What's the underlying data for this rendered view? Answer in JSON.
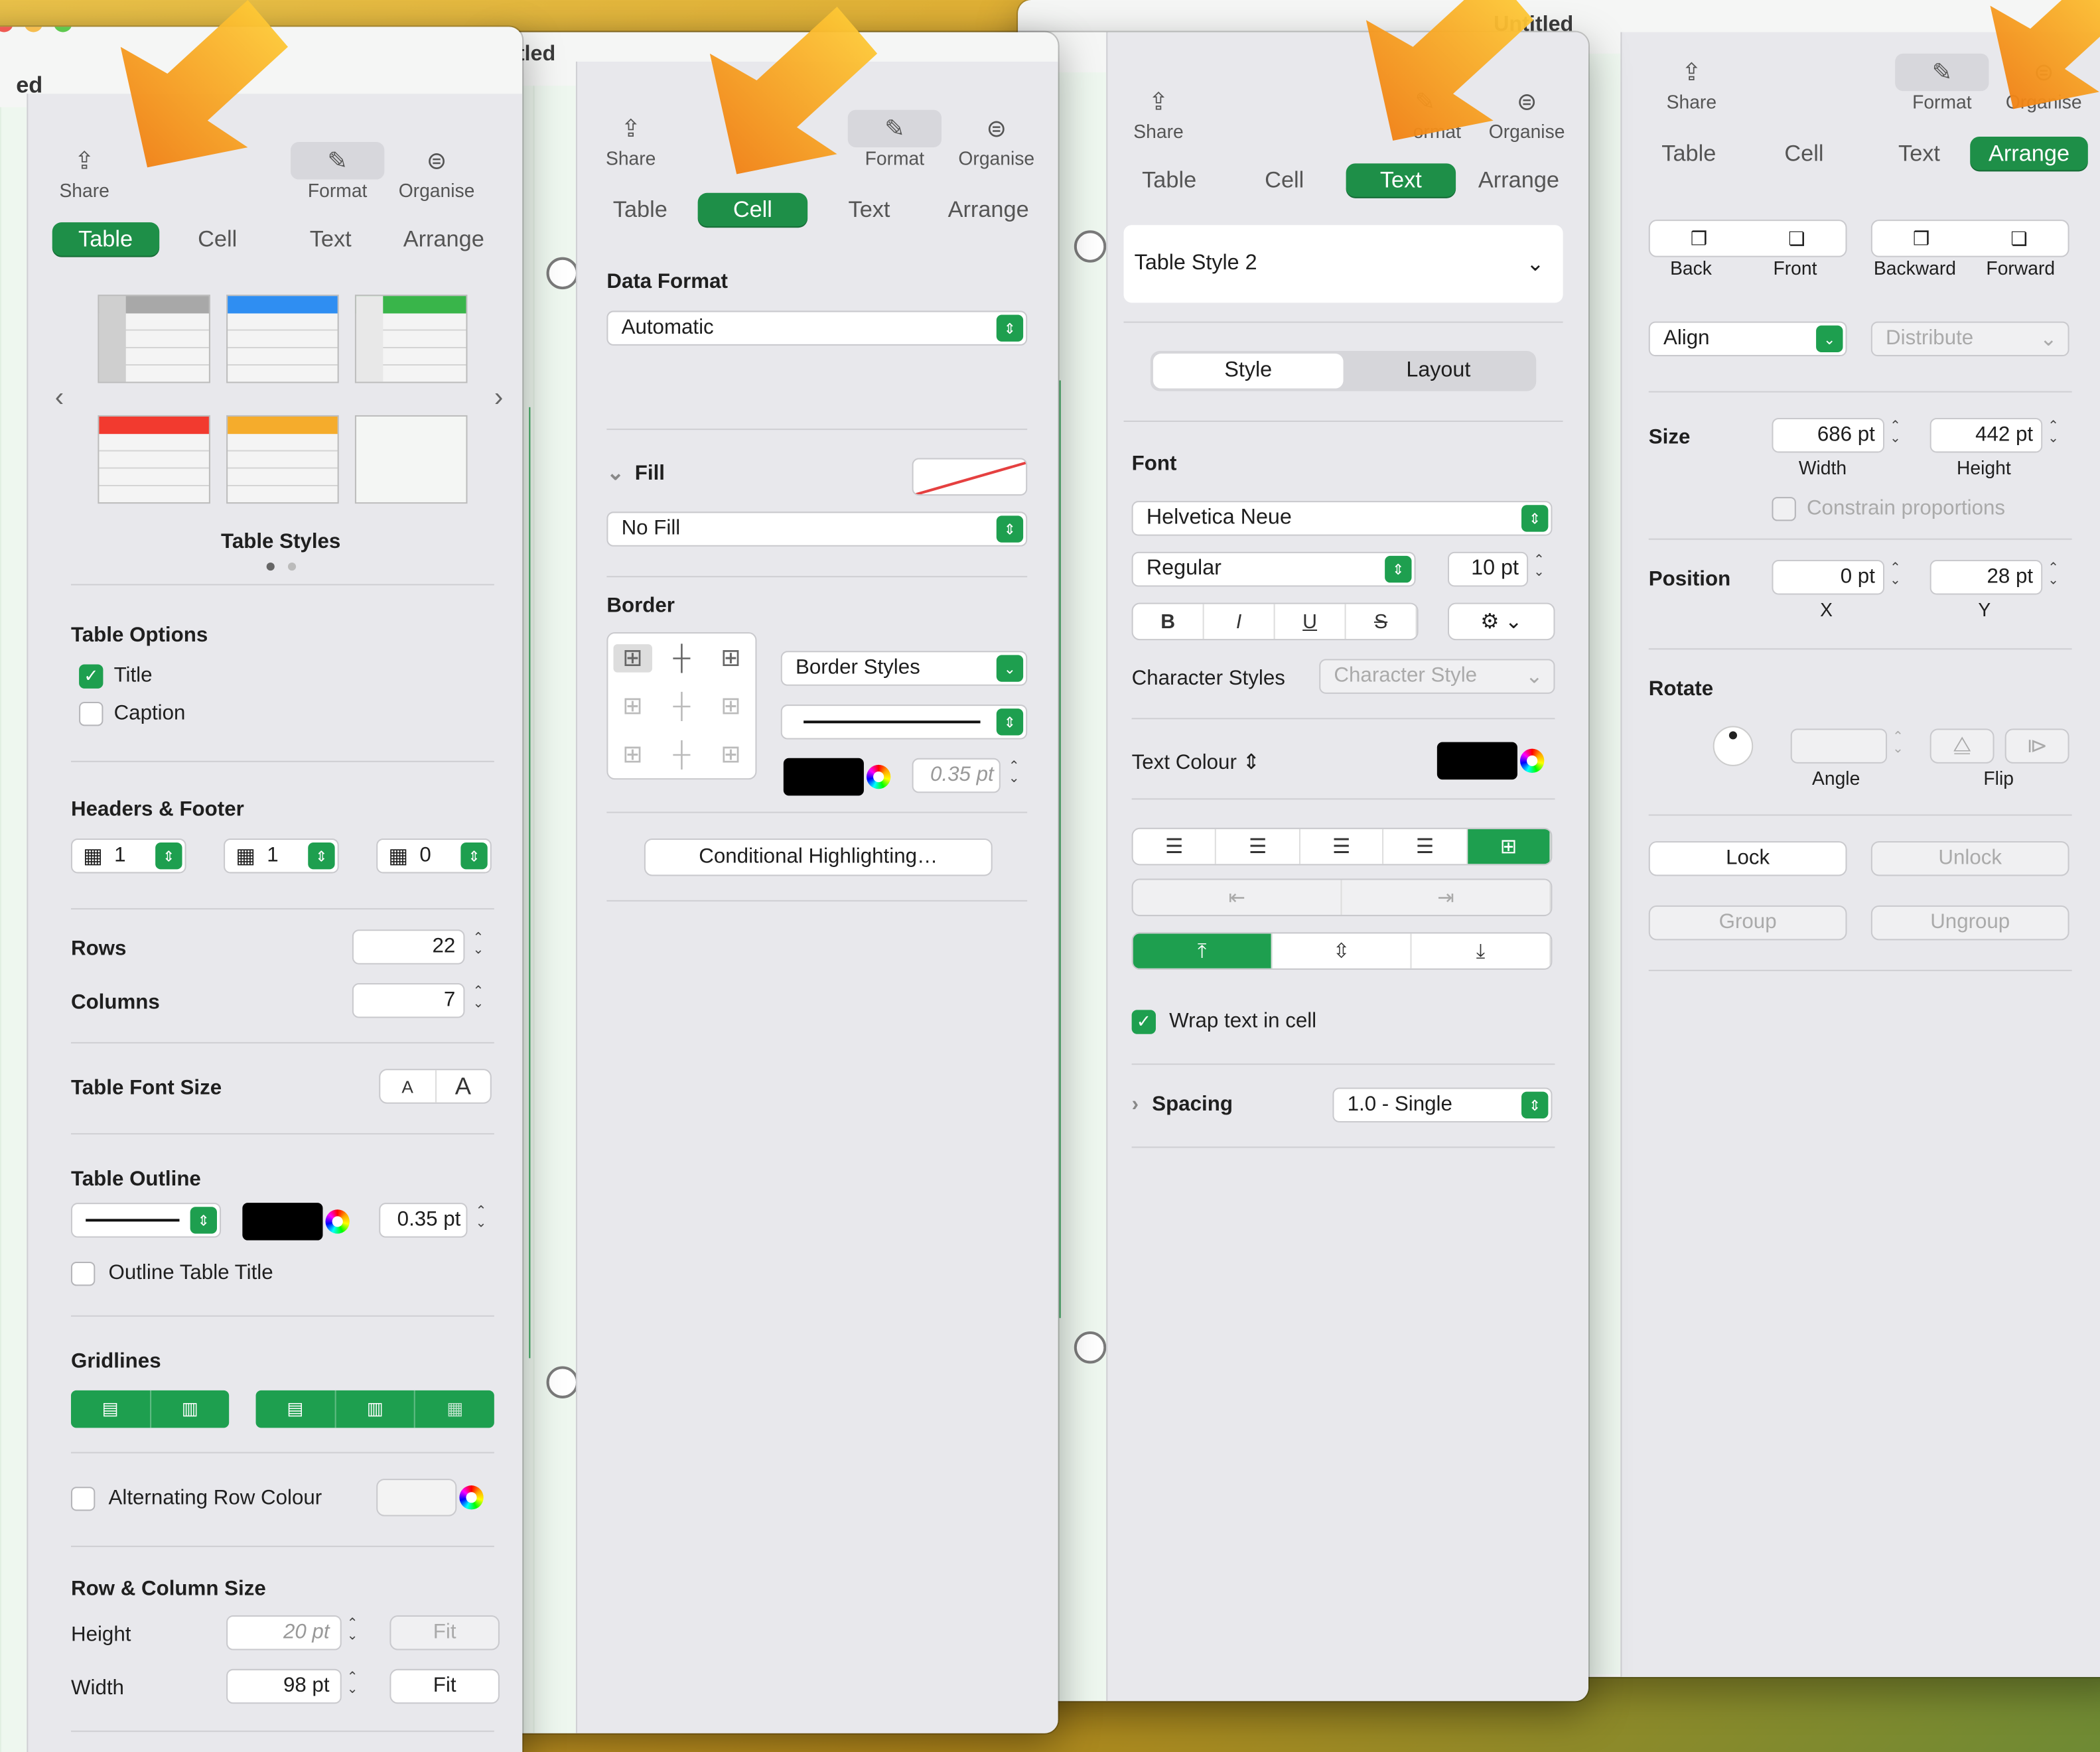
{
  "window_title": "Untitled",
  "window_title_partial": "ed",
  "toolbar": {
    "share": "Share",
    "format": "Format",
    "organise": "Organise",
    "format_partial": "ormat",
    "organise_partial": "Organise"
  },
  "tabs": [
    "Table",
    "Cell",
    "Text",
    "Arrange"
  ],
  "table_panel": {
    "styles_label": "Table Styles",
    "options_title": "Table Options",
    "title_label": "Title",
    "caption_label": "Caption",
    "headers_title": "Headers & Footer",
    "header_rows": "1",
    "header_cols": "1",
    "footer_rows": "0",
    "rows_label": "Rows",
    "rows_value": "22",
    "columns_label": "Columns",
    "columns_value": "7",
    "font_size_label": "Table Font Size",
    "font_small": "A",
    "font_large": "A",
    "outline_title": "Table Outline",
    "outline_width": "0.35 pt",
    "outline_title_label": "Outline Table Title",
    "gridlines_title": "Gridlines",
    "alt_row_label": "Alternating Row Colour",
    "rowcol_title": "Row & Column Size",
    "height_label": "Height",
    "height_value": "20 pt",
    "width_label": "Width",
    "width_value": "98 pt",
    "fit": "Fit"
  },
  "cell_panel": {
    "data_format_title": "Data Format",
    "data_format_value": "Automatic",
    "fill_title": "Fill",
    "fill_value": "No Fill",
    "border_title": "Border",
    "border_styles": "Border Styles",
    "border_width": "0.35 pt",
    "conditional": "Conditional Highlighting…"
  },
  "text_panel": {
    "style_name": "Table Style 2",
    "seg_style": "Style",
    "seg_layout": "Layout",
    "font_title": "Font",
    "font_family": "Helvetica Neue",
    "font_weight": "Regular",
    "font_size": "10 pt",
    "bold": "B",
    "italic": "I",
    "underline": "U",
    "strike": "S",
    "char_styles_label": "Character Styles",
    "char_styles_value": "Character Style",
    "text_colour": "Text Colour",
    "wrap_label": "Wrap text in cell",
    "spacing_label": "Spacing",
    "spacing_value": "1.0 - Single"
  },
  "arrange_panel": {
    "back": "Back",
    "front": "Front",
    "backward": "Backward",
    "forward": "Forward",
    "align": "Align",
    "distribute": "Distribute",
    "size_label": "Size",
    "width_value": "686 pt",
    "width_label": "Width",
    "height_value": "442 pt",
    "height_label": "Height",
    "constrain": "Constrain proportions",
    "position_label": "Position",
    "x_value": "0 pt",
    "x_label": "X",
    "y_value": "28 pt",
    "y_label": "Y",
    "rotate_label": "Rotate",
    "angle_label": "Angle",
    "flip_label": "Flip",
    "lock": "Lock",
    "unlock": "Unlock",
    "group": "Group",
    "ungroup": "Ungroup"
  },
  "colors": {
    "accent": "#1e9f4f",
    "style_blue": "#2f8ef2",
    "style_green": "#39b54a",
    "style_red": "#f23a2f",
    "style_orange": "#f5ac2c"
  }
}
